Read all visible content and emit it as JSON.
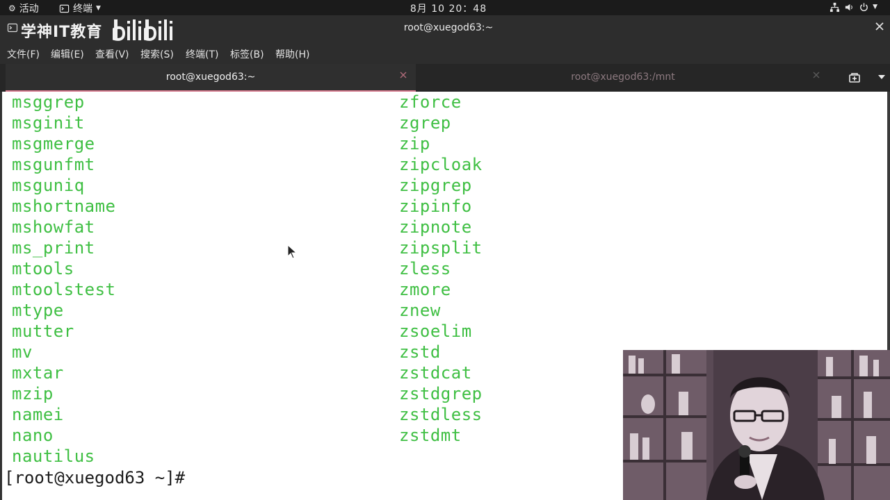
{
  "system_bar": {
    "activities": "活动",
    "app_name": "终端",
    "clock": "8月 10 20：48"
  },
  "window": {
    "watermark_text": "学神IT教育",
    "title": "root@xuegod63:~"
  },
  "menu": [
    "文件(F)",
    "编辑(E)",
    "查看(V)",
    "搜索(S)",
    "终端(T)",
    "标签(B)",
    "帮助(H)"
  ],
  "tabs": [
    {
      "label": "root@xuegod63:~",
      "active": true
    },
    {
      "label": "root@xuegod63:/mnt",
      "active": false
    }
  ],
  "terminal": {
    "left_column": [
      "msggrep",
      "msginit",
      "msgmerge",
      "msgunfmt",
      "msguniq",
      "mshortname",
      "mshowfat",
      "ms_print",
      "mtools",
      "mtoolstest",
      "mtype",
      "mutter",
      "mv",
      "mxtar",
      "mzip",
      "namei",
      "nano",
      "nautilus"
    ],
    "right_column": [
      "zforce",
      "zgrep",
      "zip",
      "zipcloak",
      "zipgrep",
      "zipinfo",
      "zipnote",
      "zipsplit",
      "zless",
      "zmore",
      "znew",
      "zsoelim",
      "zstd",
      "zstdcat",
      "zstdgrep",
      "zstdless",
      "zstdmt"
    ],
    "prompt": "[root@xuegod63 ~]#"
  },
  "colors": {
    "terminal_text": "#3fbf43",
    "terminal_bg": "#ffffff",
    "tab_accent": "#d47a8d"
  }
}
